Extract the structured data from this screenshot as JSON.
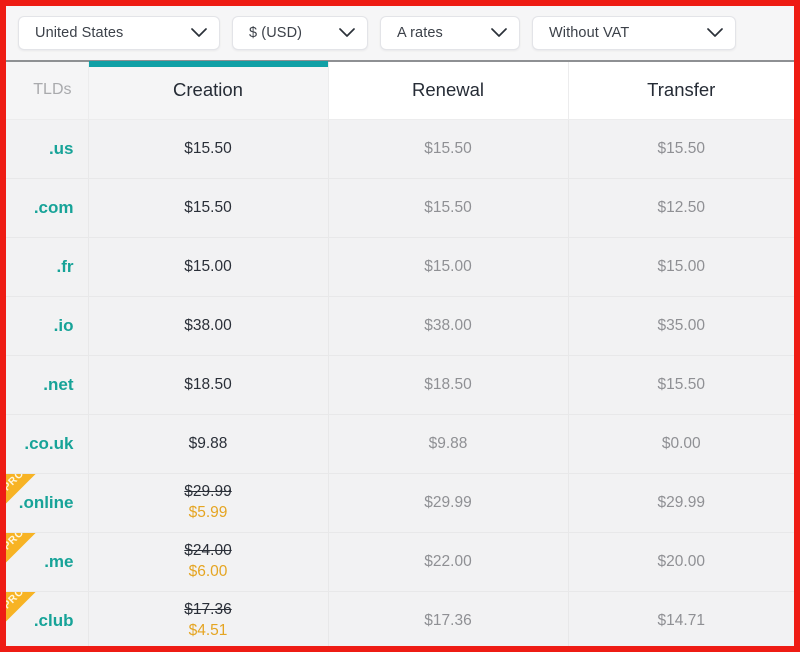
{
  "filters": [
    {
      "id": "country",
      "name": "country-select",
      "value": "United States",
      "icon": "chevron-down-icon"
    },
    {
      "id": "currency",
      "name": "currency-select",
      "value": "$ (USD)",
      "icon": "chevron-down-icon"
    },
    {
      "id": "rates",
      "name": "rates-select",
      "value": "A rates",
      "icon": "chevron-down-icon"
    },
    {
      "id": "vat",
      "name": "vat-select",
      "value": "Without VAT",
      "icon": "chevron-down-icon"
    }
  ],
  "table": {
    "columns": [
      {
        "key": "tld",
        "label": "TLDs",
        "active": false
      },
      {
        "key": "creation",
        "label": "Creation",
        "active": true
      },
      {
        "key": "renewal",
        "label": "Renewal",
        "active": false
      },
      {
        "key": "transfer",
        "label": "Transfer",
        "active": false
      }
    ],
    "accent_color": "#11a0a6",
    "tld_color": "#17a398",
    "promo_color": "#e5a522",
    "promo_badge_label": "PROMO",
    "rows": [
      {
        "tld": ".us",
        "creation": "$15.50",
        "renewal": "$15.50",
        "transfer": "$15.50",
        "promo": false
      },
      {
        "tld": ".com",
        "creation": "$15.50",
        "renewal": "$15.50",
        "transfer": "$12.50",
        "promo": false
      },
      {
        "tld": ".fr",
        "creation": "$15.00",
        "renewal": "$15.00",
        "transfer": "$15.00",
        "promo": false
      },
      {
        "tld": ".io",
        "creation": "$38.00",
        "renewal": "$38.00",
        "transfer": "$35.00",
        "promo": false
      },
      {
        "tld": ".net",
        "creation": "$18.50",
        "renewal": "$18.50",
        "transfer": "$15.50",
        "promo": false
      },
      {
        "tld": ".co.uk",
        "creation": "$9.88",
        "renewal": "$9.88",
        "transfer": "$0.00",
        "promo": false
      },
      {
        "tld": ".online",
        "creation_old": "$29.99",
        "creation": "$5.99",
        "renewal": "$29.99",
        "transfer": "$29.99",
        "promo": true
      },
      {
        "tld": ".me",
        "creation_old": "$24.00",
        "creation": "$6.00",
        "renewal": "$22.00",
        "transfer": "$20.00",
        "promo": true
      },
      {
        "tld": ".club",
        "creation_old": "$17.36",
        "creation": "$4.51",
        "renewal": "$17.36",
        "transfer": "$14.71",
        "promo": true
      }
    ]
  }
}
